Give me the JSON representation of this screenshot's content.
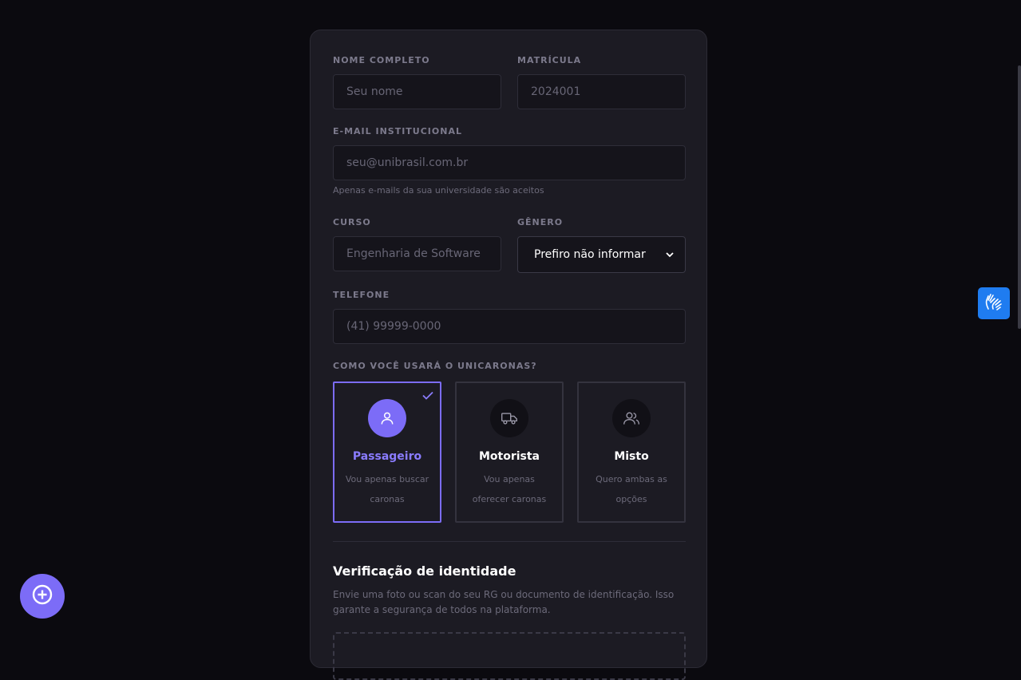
{
  "form": {
    "name": {
      "label": "NOME COMPLETO",
      "placeholder": "Seu nome"
    },
    "registration": {
      "label": "MATRÍCULA",
      "placeholder": "2024001"
    },
    "email": {
      "label": "E-MAIL INSTITUCIONAL",
      "placeholder": "seu@unibrasil.com.br",
      "hint": "Apenas e-mails da sua universidade são aceitos"
    },
    "course": {
      "label": "CURSO",
      "placeholder": "Engenharia de Software"
    },
    "gender": {
      "label": "GÊNERO",
      "selected": "Prefiro não informar"
    },
    "phone": {
      "label": "TELEFONE",
      "placeholder": "(41) 99999-0000"
    },
    "usage": {
      "label": "COMO VOCÊ USARÁ O UNICARONAS?",
      "options": [
        {
          "title": "Passageiro",
          "desc": "Vou apenas buscar caronas",
          "icon": "user-icon",
          "selected": true
        },
        {
          "title": "Motorista",
          "desc": "Vou apenas oferecer caronas",
          "icon": "truck-icon",
          "selected": false
        },
        {
          "title": "Misto",
          "desc": "Quero ambas as opções",
          "icon": "users-icon",
          "selected": false
        }
      ]
    },
    "identity": {
      "title": "Verificação de identidade",
      "desc": "Envie uma foto ou scan do seu RG ou documento de identificação. Isso garante a segurança de todos na plataforma."
    }
  },
  "colors": {
    "accent": "#7c6cf7",
    "background": "#0b0a0f",
    "card": "#1c1b23",
    "a11y": "#1f7cf0"
  },
  "icons": {
    "fab": "plus-circle-icon",
    "a11y": "sign-language-hands-icon",
    "check": "check-icon"
  }
}
